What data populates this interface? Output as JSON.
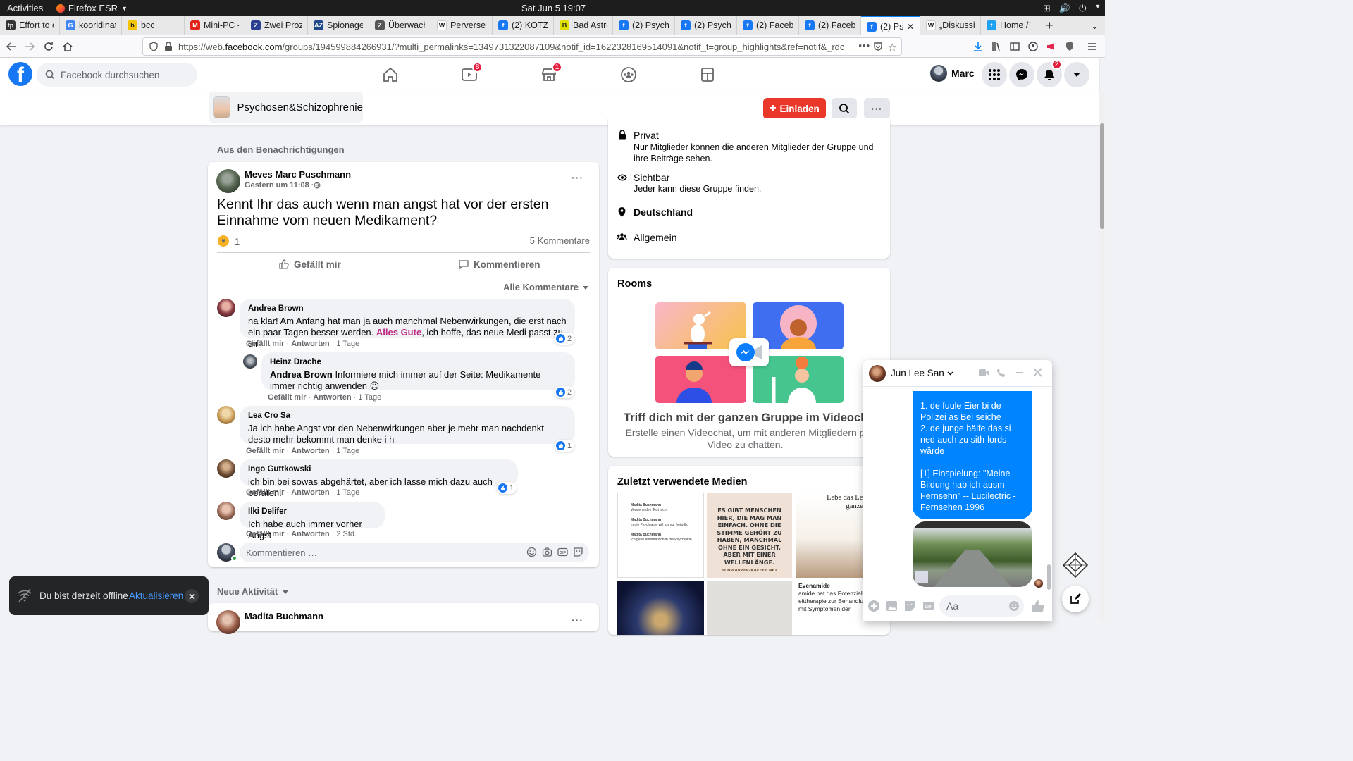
{
  "os": {
    "activities": "Activities",
    "app": "Firefox ESR",
    "clock": "Sat Jun 5  19:07"
  },
  "tabs": [
    {
      "label": "Effort to c",
      "color": "#333333",
      "icon": "tp"
    },
    {
      "label": "kooridinat",
      "color": "#4285f4",
      "icon": "G"
    },
    {
      "label": "bcc",
      "color": "#f5c400",
      "icon": "b"
    },
    {
      "label": "Mini-PC -",
      "color": "#e2231a",
      "icon": "M"
    },
    {
      "label": "Zwei Proz",
      "color": "#2a3f8f",
      "icon": "Z"
    },
    {
      "label": "Spionage",
      "color": "#1f4a8a",
      "icon": "AZ"
    },
    {
      "label": "Überwach",
      "color": "#555555",
      "icon": "Z"
    },
    {
      "label": "Perverse",
      "color": "#ffffff",
      "icon": "W"
    },
    {
      "label": "(2) KOTZ",
      "color": "#1877f2",
      "icon": "f"
    },
    {
      "label": "Bad Astro",
      "color": "#e0e000",
      "icon": "B"
    },
    {
      "label": "(2) Psych",
      "color": "#1877f2",
      "icon": "f"
    },
    {
      "label": "(2) Psych",
      "color": "#1877f2",
      "icon": "f"
    },
    {
      "label": "(2) Faceb",
      "color": "#1877f2",
      "icon": "f"
    },
    {
      "label": "(2) Faceb",
      "color": "#1877f2",
      "icon": "f"
    },
    {
      "label": "(2) Psy",
      "color": "#1877f2",
      "icon": "f",
      "active": true
    },
    {
      "label": "„Diskussi",
      "color": "#ffffff",
      "icon": "W"
    },
    {
      "label": "Home / Tv",
      "color": "#1da1f2",
      "icon": "t"
    }
  ],
  "url": {
    "prefix": "https://web.",
    "domain": "facebook.com",
    "rest": "/groups/194599884266931/?multi_permalinks=1349731322087109&notif_id=1622328169514091&notif_t=group_highlights&ref=notif&_rdc"
  },
  "fb": {
    "search_placeholder": "Facebook durchsuchen",
    "watch_badge": "8",
    "market_badge": "1",
    "user_name": "Marc",
    "notif_badge": "2"
  },
  "group": {
    "name": "Psychosen&Schizophrenie",
    "invite": "Einladen"
  },
  "feed": {
    "section_title": "Aus den Benachrichtigungen",
    "post": {
      "author": "Meves Marc Puschmann",
      "time": "Gestern um 11:08 · ",
      "text": "Kennt Ihr das auch wenn man angst hat vor der ersten Einnahme vom neuen Medikament?",
      "reactions": "1",
      "comments_count": "5 Kommentare",
      "like_label": "Gefällt mir",
      "comment_label": "Kommentieren",
      "all_comments": "Alle Kommentare"
    },
    "comments": [
      {
        "name": "Andrea Brown",
        "text_a": "na klar! Am Anfang hat man ja auch manchmal Nebenwirkungen, die erst nach ein paar Tagen besser werden. ",
        "highlight": "Alles Gute",
        "text_b": ", ich hoffe, das neue Medi passt zu dir",
        "likes": "2",
        "like": "Gefällt mir",
        "reply": "Antworten",
        "age": "1 Tage"
      },
      {
        "name": "Heinz Drache",
        "mention": "Andrea Brown",
        "text_a": " Informiere mich immer auf der Seite: Medikamente immer richtig anwenden 😉",
        "likes": "2",
        "like": "Gefällt mir",
        "reply": "Antworten",
        "age": "1 Tage"
      },
      {
        "name": "Lea Cro Sa",
        "text_a": "Ja ich habe Angst vor den Nebenwirkungen aber je mehr man nachdenkt desto mehr bekommt man denke i h",
        "likes": "1",
        "like": "Gefällt mir",
        "reply": "Antworten",
        "age": "1 Tage"
      },
      {
        "name": "Ingo Guttkowski",
        "text_a": "ich bin bei sowas abgehärtet, aber ich lasse mich dazu auch beraten.",
        "likes": "1",
        "like": "Gefällt mir",
        "reply": "Antworten",
        "age": "1 Tage"
      },
      {
        "name": "Ilki Delifer",
        "text_a": "Ich habe auch immer vorher Angst",
        "like": "Gefällt mir",
        "reply": "Antworten",
        "age": "2 Std."
      }
    ],
    "comment_placeholder": "Kommentieren …",
    "new_activity": "Neue Aktivität",
    "next_author": "Madita Buchmann"
  },
  "about": {
    "private_title": "Privat",
    "private_desc": "Nur Mitglieder können die anderen Mitglieder der Gruppe und ihre Beiträge sehen.",
    "visible_title": "Sichtbar",
    "visible_desc": "Jeder kann diese Gruppe finden.",
    "location": "Deutschland",
    "category": "Allgemein"
  },
  "rooms": {
    "title": "Rooms",
    "headline": "Triff dich mit der ganzen Gruppe im Videoch",
    "desc": "Erstelle einen Videochat, um mit anderen Mitgliedern p Video zu chatten."
  },
  "media": {
    "title": "Zuletzt verwendete Medien",
    "thumb1_lines": [
      "Madita Buchmann",
      "Verstehe den Text nicht",
      "Madita Buchmann",
      "In die Psychiatrie will ich nur freiwillig",
      "Madita Buchmann",
      "Ich gehe automatisch in die Psychiatrie"
    ],
    "thumb2_text": "ES GIBT MENSCHEN HIER, DIE MAG MAN EINFACH. OHNE DIE STIMME GEHÖRT ZU HABEN, MANCHMAL OHNE EIN GESICHT, ABER MIT EINER WELLENLÄNGE.",
    "thumb2_src": "SCHWARZER-KAFFEE.NET",
    "thumb3_text": "Lebe das Leb von ganze Herz",
    "thumb6_title": "Evenamide",
    "thumb6_text": "amide hat das Potenzial, d eittherapie zur Behandlung n mit Symptomen der"
  },
  "chat": {
    "name": "Jun Lee San",
    "msg_lines": [
      "1. de fuule Eier bi de Polizei as Bei seiche",
      "2. de junge hälfe das si ned auch zu sith-lords wärde",
      "",
      "[1] Einspielung: \"Meine Bildung hab ich ausm Fernsehn\" -- Lucilectric - Fernsehen 1996"
    ],
    "input_placeholder": "Aa"
  },
  "toast": {
    "text": "Du bist derzeit offline.",
    "action": "Aktualisieren"
  }
}
